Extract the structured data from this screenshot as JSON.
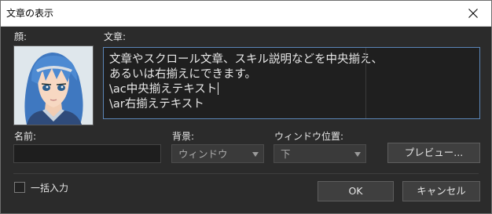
{
  "window": {
    "title": "文章の表示",
    "close_icon": "close-icon"
  },
  "face": {
    "label": "顔:",
    "image": "face-portrait-blue-haired-character"
  },
  "message": {
    "label": "文章:",
    "lines": [
      "文章やスクロール文章、スキル説明などを中央揃え、",
      "あるいは右揃えにできます。",
      "\\ac中央揃えテキスト",
      "\\ar右揃えテキスト"
    ]
  },
  "name": {
    "label": "名前:",
    "value": ""
  },
  "background": {
    "label": "背景:",
    "selected": "ウィンドウ"
  },
  "window_position": {
    "label": "ウィンドウ位置:",
    "selected": "下"
  },
  "buttons": {
    "preview": "プレビュー...",
    "ok": "OK",
    "cancel": "キャンセル"
  },
  "batch_input": {
    "label": "一括入力",
    "checked": false
  },
  "colors": {
    "dialog_bg": "#2b2b2b",
    "textarea_focus_border": "#5b86b8"
  }
}
